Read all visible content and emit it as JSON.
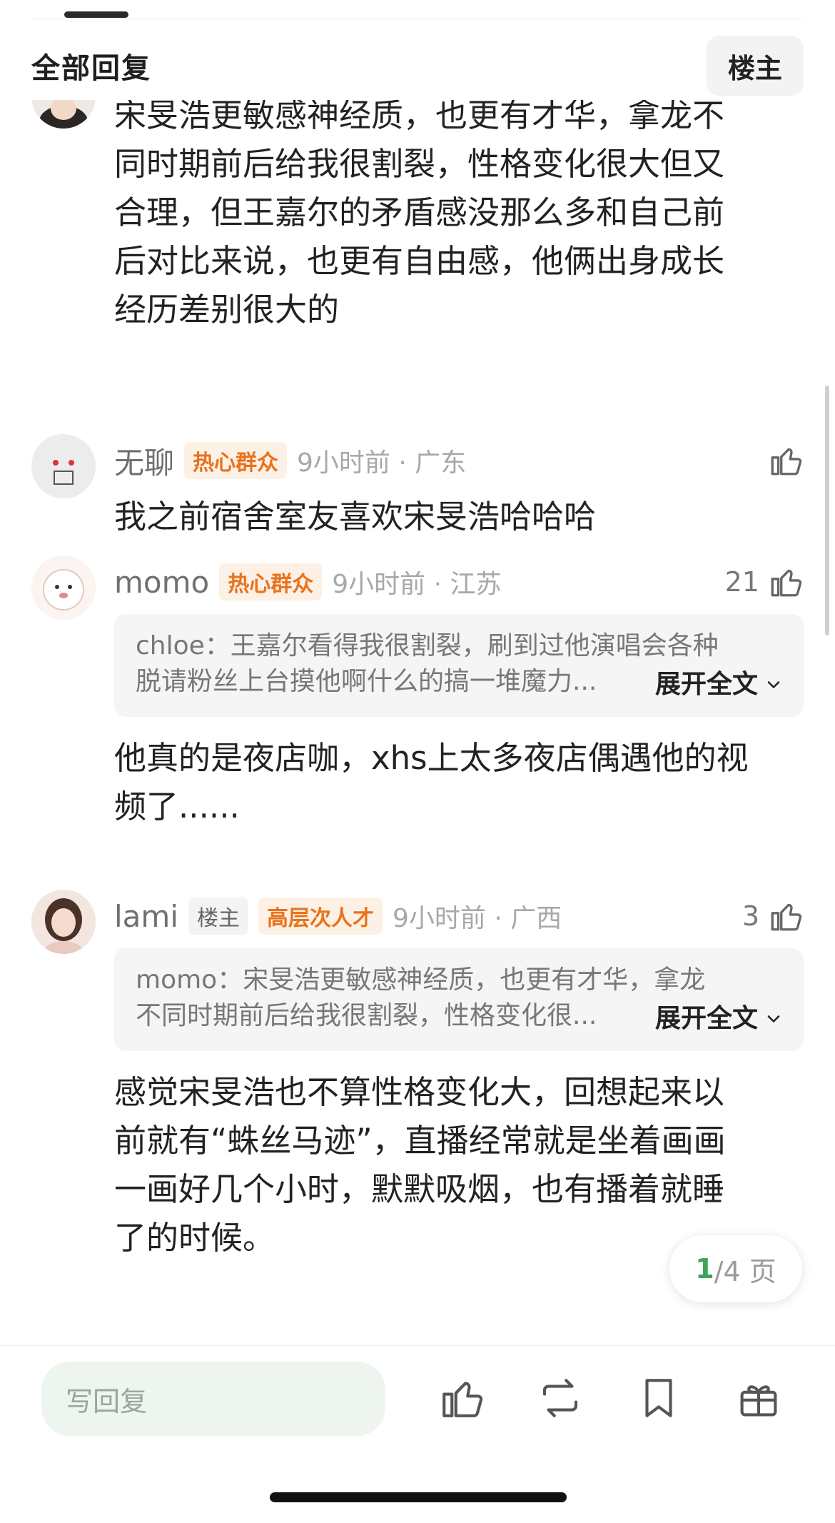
{
  "header": {
    "title": "全部回复",
    "owner_button": "楼主"
  },
  "comments": [
    {
      "text": "宋旻浩更敏感神经质，也更有才华，拿龙不同时期前后给我很割裂，性格变化很大但又合理，但王嘉尔的矛盾感没那么多和自己前后对比来说，也更有自由感，他俩出身成长经历差别很大的",
      "text_lines": [
        "宋旻浩更敏感神经质，也更有才华，拿龙不",
        "同时期前后给我很割裂，性格变化很大但又",
        "合理，但王嘉尔的矛盾感没那么多和自己前",
        "后对比来说，也更有自由感，他俩出身成长",
        "经历差别很大的"
      ]
    },
    {
      "username": "无聊",
      "badge": "热心群众",
      "time": "9小时前 · 广东",
      "likes": "",
      "text_lines": [
        "我之前宿舍室友喜欢宋旻浩哈哈哈"
      ]
    },
    {
      "username": "momo",
      "badge": "热心群众",
      "time": "9小时前 · 江苏",
      "likes": "21",
      "quote_lines": [
        "chloe：王嘉尔看得我很割裂，刷到过他演唱会各种",
        "脱请粉丝上台摸他啊什么的搞一堆魔力..."
      ],
      "expand": "展开全文",
      "text_lines": [
        "他真的是夜店咖，xhs上太多夜店偶遇他的视",
        "频了......"
      ]
    },
    {
      "username": "lami",
      "owner_badge": "楼主",
      "badge": "高层次人才",
      "time": "9小时前 · 广西",
      "likes": "3",
      "quote_lines": [
        "momo：宋旻浩更敏感神经质，也更有才华，拿龙",
        "不同时期前后给我很割裂，性格变化很..."
      ],
      "expand": "展开全文",
      "text_lines": [
        "感觉宋旻浩也不算性格变化大，回想起来以",
        "前就有“蛛丝马迹”，直播经常就是坐着画画",
        "一画好几个小时，默默吸烟，也有播着就睡",
        "了的时候。"
      ]
    }
  ],
  "pagination": {
    "current": "1",
    "total": "/4 页"
  },
  "bottom_bar": {
    "reply_placeholder": "写回复"
  },
  "colors": {
    "badge_orange": "#e8731d",
    "badge_bg": "#fdf1e6",
    "page_green": "#3ca55c",
    "reply_bg": "#eef4ee"
  },
  "icons": [
    "thumbs-up-icon",
    "repost-icon",
    "bookmark-icon",
    "gift-icon",
    "chevron-down-icon"
  ]
}
